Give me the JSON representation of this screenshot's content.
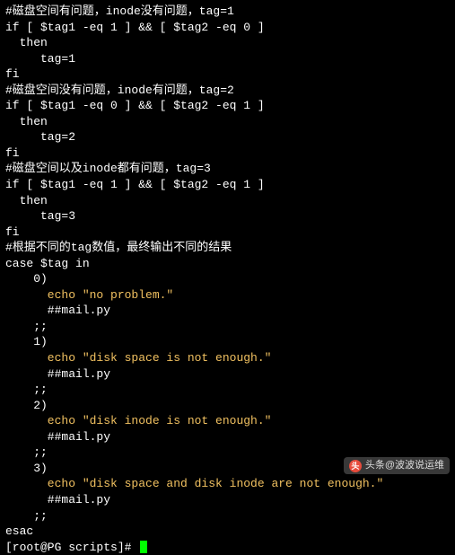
{
  "lines": {
    "c1": "#磁盘空间有问题，inode没有问题，tag=1",
    "l1": "if [ $tag1 -eq 1 ] && [ $tag2 -eq 0 ]",
    "l2": "  then",
    "l3": "     tag=1",
    "l4": "fi",
    "c2": "#磁盘空间没有问题，inode有问题，tag=2",
    "l5": "if [ $tag1 -eq 0 ] && [ $tag2 -eq 1 ]",
    "l6": "  then",
    "l7": "     tag=2",
    "l8": "fi",
    "c3": "#磁盘空间以及inode都有问题，tag=3",
    "l9": "if [ $tag1 -eq 1 ] && [ $tag2 -eq 1 ]",
    "l10": "  then",
    "l11": "     tag=3",
    "l12": "fi",
    "c4": "#根据不同的tag数值，最终输出不同的结果",
    "l13": "case $tag in",
    "l14": "    0)",
    "l15": "      echo \"no problem.\"",
    "l16": "      ##mail.py",
    "l17": "    ;;",
    "l18": "    1)",
    "l19": "      echo \"disk space is not enough.\"",
    "l20": "      ##mail.py",
    "l21": "    ;;",
    "l22": "    2)",
    "l23": "      echo \"disk inode is not enough.\"",
    "l24": "      ##mail.py",
    "l25": "    ;;",
    "l26": "    3)",
    "l27": "      echo \"disk space and disk inode are not enough.\"",
    "l28": "      ##mail.py",
    "l29": "    ;;",
    "l30": "esac",
    "prompt": "[root@PG scripts]# "
  },
  "watermark": {
    "icon": "头",
    "text": "头条@波波说运维"
  }
}
